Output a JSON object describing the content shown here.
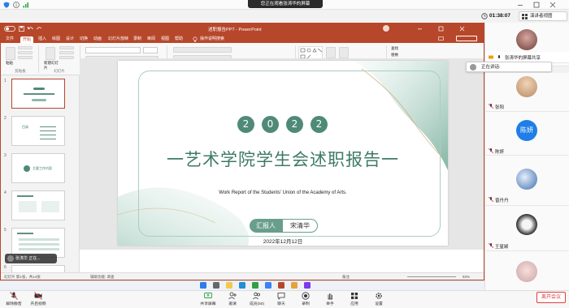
{
  "meeting": {
    "share_banner": "您正在观看张涛华的屏幕",
    "clock": "01:38:07",
    "view_button": "演讲者视图",
    "speaking": "正在讲话:",
    "leave": "离开会议"
  },
  "ppt": {
    "title": "述职报告PPT - PowerPoint",
    "tabs": [
      "文件",
      "开始",
      "插入",
      "绘图",
      "设计",
      "切换",
      "动画",
      "幻灯片放映",
      "录制",
      "审阅",
      "视图",
      "帮助",
      "操作说明搜索"
    ],
    "groups": [
      "剪贴板",
      "幻灯片",
      "字体",
      "段落",
      "绘图",
      "编辑"
    ],
    "ribbon_labels": {
      "paste": "粘贴",
      "new_slide": "新建幻灯片",
      "arrange": "排列",
      "quick_styles": "快速样式",
      "find": "查找",
      "replace": "替换",
      "select": "选择"
    },
    "slide_numbers": [
      "1",
      "2",
      "3",
      "4",
      "5",
      "6"
    ],
    "thumb_texts": [
      "目录",
      "主要工作内容"
    ],
    "status": {
      "left": "幻灯片 第1张，共14张",
      "mid": "辅助功能: 调查",
      "notes": "备注",
      "zoom": "93%"
    },
    "notification": "张涛华 正在..."
  },
  "slide": {
    "year_digits": [
      "2",
      "0",
      "2",
      "2"
    ],
    "title": "一艺术学院学生会述职报告一",
    "subtitle": "Work Report of the Students' Union of the Academy of Arts.",
    "reporter_label": "汇报人",
    "reporter_name": "宋清华",
    "date": "2022年12月12日"
  },
  "participants": [
    {
      "name": "",
      "role": "presenter-tile",
      "color": "#6b3f3a"
    },
    {
      "name": "张涛华的屏幕共享",
      "role": "sharing",
      "color": "#b7472a"
    },
    {
      "name": "张阳",
      "role": "photo",
      "color": "#d9b48f"
    },
    {
      "name": "陈妍",
      "role": "initials",
      "color": "#1f7ee8"
    },
    {
      "name": "曾丹丹",
      "role": "photo",
      "color": "#3b6fb0"
    },
    {
      "name": "王星颖",
      "role": "photo",
      "color": "#2d2d2d"
    },
    {
      "name": "",
      "role": "photo",
      "color": "#c9a3a3"
    }
  ],
  "toolbar": [
    "解除静音",
    "开启视频",
    "共享屏幕",
    "邀请",
    "成员(50)",
    "聊天",
    "录制",
    "举手",
    "应用",
    "设置"
  ]
}
